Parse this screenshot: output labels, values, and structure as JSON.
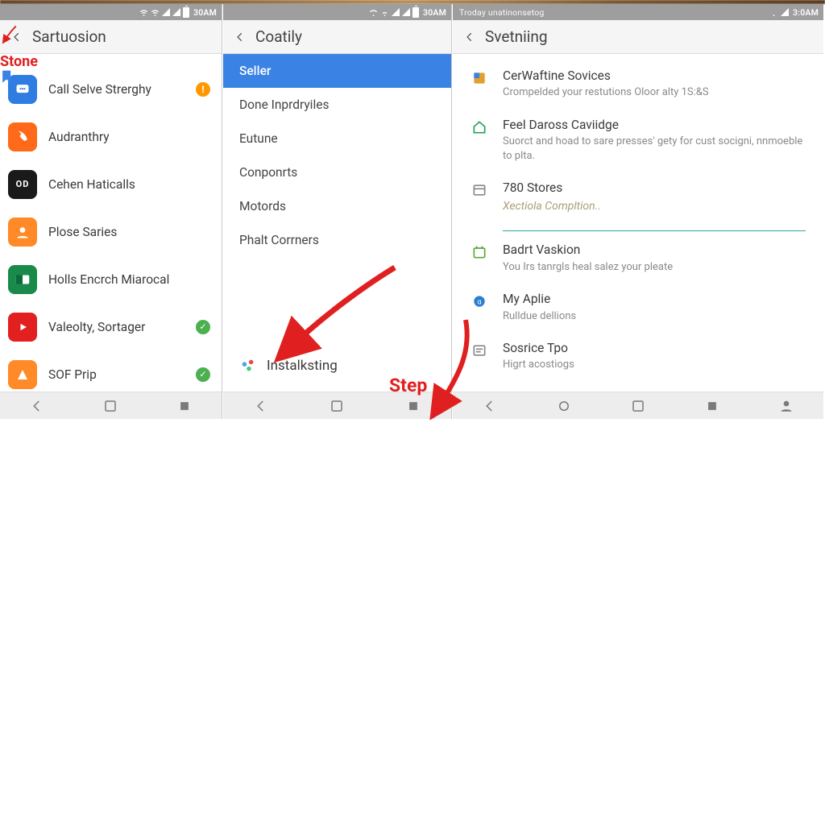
{
  "panel1": {
    "status_time": "30AM",
    "title": "Sartuosion",
    "items": [
      {
        "label": "Call Selve Strerghy",
        "icon_bg": "#2f7de2",
        "icon_inner": "msg",
        "badge": "alert"
      },
      {
        "label": "Audranthry",
        "icon_bg": "#ff6a1a",
        "icon_inner": "phone",
        "badge": ""
      },
      {
        "label": "Cehen Haticalls",
        "icon_bg": "#1a1a1a",
        "icon_inner": "OD",
        "badge": ""
      },
      {
        "label": "Plose Saries",
        "icon_bg": "#ff8a27",
        "icon_inner": "person",
        "badge": ""
      },
      {
        "label": "Holls Encrch Miarocal",
        "icon_bg": "#1a8a4a",
        "icon_inner": "card",
        "badge": ""
      },
      {
        "label": "Valeolty, Sortager",
        "icon_bg": "#e22020",
        "icon_inner": "yt",
        "badge": "check"
      },
      {
        "label": "SOF Prip",
        "icon_bg": "#ff8a27",
        "icon_inner": "tri",
        "badge": "check"
      }
    ]
  },
  "panel2": {
    "status_time": "30AM",
    "title": "Coatily",
    "categories": [
      "Seller",
      "Done Inprdryiles",
      "Eutune",
      "Conponrts",
      "Motords",
      "Phalt Corrners"
    ],
    "install": "Instalksting"
  },
  "panel3": {
    "status_left": "Troday unatinonsetog",
    "status_time": "3:0AM",
    "title": "Svetniing",
    "items": [
      {
        "title": "CerWaftine Sovices",
        "sub": "Crompelded your restutions\nOloor alty 1S:&S"
      },
      {
        "title": "Feel Daross Caviidge",
        "sub": "Suorct and hoad to sare presses' gety for cust socigni, nnmoeble to plta."
      },
      {
        "title": "780 Stores",
        "placeholder": "Xectiola Compltion.."
      },
      {
        "title": "Badrt Vaskion",
        "sub": "You Irs tanrgls heal salez your pleate"
      },
      {
        "title": "My Aplie",
        "sub": "Rulldue dellions"
      },
      {
        "title": "Sosrice Tpo",
        "sub": "Higrt acostiogs"
      }
    ]
  },
  "annotations": {
    "step1": "Stone",
    "step2": "Step"
  }
}
